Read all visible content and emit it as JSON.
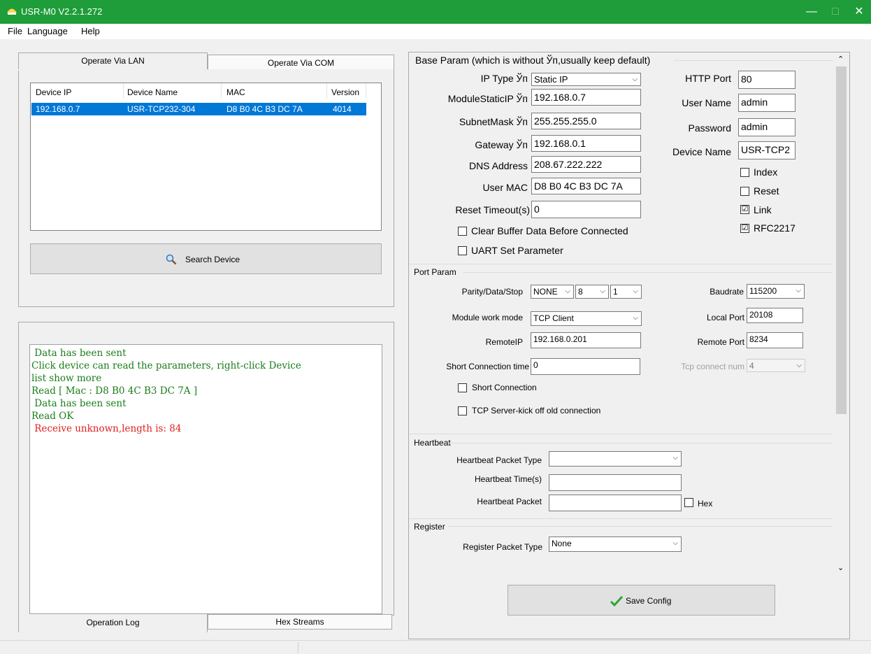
{
  "window": {
    "title": "USR-M0 V2.2.1.272",
    "minimize": "—",
    "maximize": "□",
    "close": "✕"
  },
  "menu": [
    "File",
    "Language",
    "Help"
  ],
  "left": {
    "tabs": {
      "lan": "Operate Via LAN",
      "com": "Operate Via COM"
    },
    "device_table": {
      "headers": [
        "Device IP",
        "Device Name",
        "MAC",
        "Version"
      ],
      "rows": [
        [
          "192.168.0.7",
          "USR-TCP232-304",
          "D8 B0 4C B3 DC 7A",
          "4014"
        ]
      ]
    },
    "search_button": "Search Device",
    "log_lines": [
      {
        "text": " Data has been sent",
        "color": "#1a7d1a"
      },
      {
        "text": "Click device can read the parameters, right-click Device",
        "color": "#1a7d1a"
      },
      {
        "text": "list show more",
        "color": "#1a7d1a"
      },
      {
        "text": "Read [ Mac : D8 B0 4C B3 DC 7A ]",
        "color": "#1a7d1a"
      },
      {
        "text": " Data has been sent",
        "color": "#1a7d1a"
      },
      {
        "text": "Read OK",
        "color": "#1a7d1a"
      },
      {
        "text": " Receive unknown,length is: 84",
        "color": "#e02020"
      }
    ],
    "bottom_tabs": {
      "log": "Operation Log",
      "hex": "Hex Streams"
    }
  },
  "base": {
    "title": "Base Param (which is without Ўп,usually keep default)",
    "ip_type_label": "IP Type Ўп",
    "ip_type_value": "Static IP",
    "static_ip_label": "ModuleStaticIP Ўп",
    "static_ip_value": "192.168.0.7",
    "subnet_label": "SubnetMask Ўп",
    "subnet_value": "255.255.255.0",
    "gateway_label": "Gateway Ўп",
    "gateway_value": "192.168.0.1",
    "dns_label": "DNS Address",
    "dns_value": "208.67.222.222",
    "mac_label": "User MAC",
    "mac_value": "D8 B0 4C B3 DC 7A",
    "reset_timeout_label": "Reset Timeout(s)",
    "reset_timeout_value": "0",
    "clear_buffer_label": "Clear Buffer Data Before Connected",
    "uart_label": "UART Set Parameter",
    "http_port_label": "HTTP Port",
    "http_port_value": "80",
    "user_name_label": "User Name",
    "user_name_value": "admin",
    "password_label": "Password",
    "password_value": "admin",
    "device_name_label": "Device Name",
    "device_name_value": "USR-TCP2",
    "index_label": "Index",
    "reset_label": "Reset",
    "link_label": "Link",
    "rfc_label": "RFC2217",
    "link_checked": "☑",
    "rfc_checked": "☑"
  },
  "port": {
    "title": "Port Param",
    "pds_label": "Parity/Data/Stop",
    "parity": "NONE",
    "data": "8",
    "stop": "1",
    "baudrate_label": "Baudrate",
    "baudrate": "115200",
    "mode_label": "Module work mode",
    "mode": "TCP Client",
    "local_port_label": "Local Port",
    "local_port": "20108",
    "remote_ip_label": "RemoteIP",
    "remote_ip": "192.168.0.201",
    "remote_port_label": "Remote Port",
    "remote_port": "8234",
    "short_time_label": "Short Connection time",
    "short_time": "0",
    "tcp_num_label": "Tcp connect num",
    "tcp_num": "4",
    "short_conn_label": "Short Connection",
    "kick_label": "TCP Server-kick off old connection"
  },
  "heartbeat": {
    "title": "Heartbeat",
    "type_label": "Heartbeat Packet Type",
    "type_value": "",
    "time_label": "Heartbeat Time(s)",
    "time_value": "",
    "packet_label": "Heartbeat Packet",
    "packet_value": "",
    "hex_label": "Hex"
  },
  "register": {
    "title": "Register",
    "type_label": "Register Packet Type",
    "type_value": "None"
  },
  "save_button": "Save Config",
  "colors": {
    "titlebar": "#1e9d3a",
    "selection": "#0078d7"
  }
}
